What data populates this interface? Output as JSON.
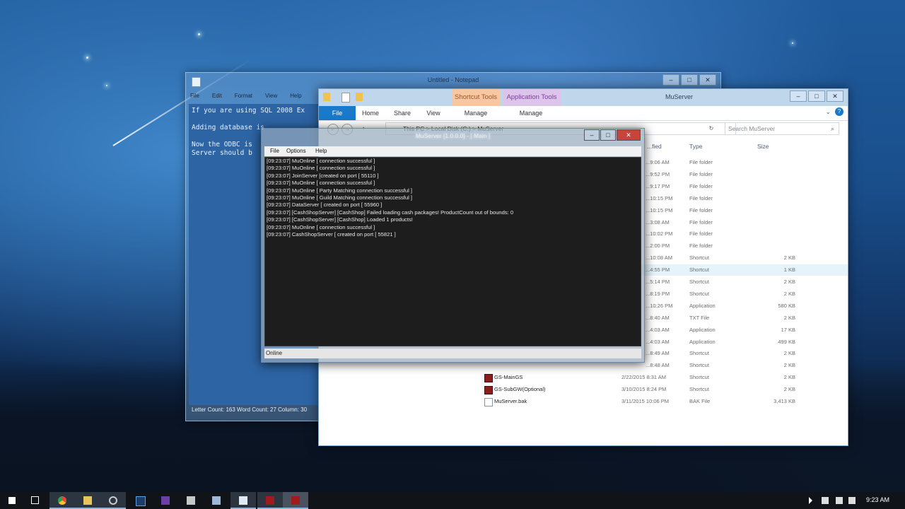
{
  "notepad": {
    "title": "Untitled - Notepad",
    "menu": [
      "File",
      "Edit",
      "Format",
      "View",
      "Help"
    ],
    "lines": [
      "If you are using SQL 2008 Ex",
      "",
      "Adding database is",
      "",
      "Now the ODBC is",
      "Server should b"
    ],
    "status": "Letter Count: 163  Word Count: 27  Column: 30"
  },
  "explorer": {
    "title": "MuServer",
    "context_tabs": [
      "Shortcut Tools",
      "Application Tools"
    ],
    "tabs": [
      "File",
      "Home",
      "Share",
      "View",
      "Manage",
      "Manage"
    ],
    "address": "This PC  >  Local Disk (C:)  >  MuServer",
    "search_placeholder": "Search MuServer",
    "columns": [
      "...fied",
      "Type",
      "Size"
    ],
    "rows": [
      {
        "date": "...9:06 AM",
        "type": "File folder",
        "size": ""
      },
      {
        "date": "...9:52 PM",
        "type": "File folder",
        "size": ""
      },
      {
        "date": "...9:17 PM",
        "type": "File folder",
        "size": ""
      },
      {
        "date": "...10:15 PM",
        "type": "File folder",
        "size": ""
      },
      {
        "date": "...10:15 PM",
        "type": "File folder",
        "size": ""
      },
      {
        "date": "...3:08 AM",
        "type": "File folder",
        "size": ""
      },
      {
        "date": "...10:02 PM",
        "type": "File folder",
        "size": ""
      },
      {
        "date": "...2:00 PM",
        "type": "File folder",
        "size": ""
      },
      {
        "date": "...10:08 AM",
        "type": "Shortcut",
        "size": "2 KB"
      },
      {
        "date": "...4:55 PM",
        "type": "Shortcut",
        "size": "1 KB"
      },
      {
        "date": "...5:14 PM",
        "type": "Shortcut",
        "size": "2 KB"
      },
      {
        "date": "...8:19 PM",
        "type": "Shortcut",
        "size": "2 KB"
      },
      {
        "date": "...10:26 PM",
        "type": "Application",
        "size": "580 KB"
      },
      {
        "date": "...8:40 AM",
        "type": "TXT File",
        "size": "2 KB"
      },
      {
        "date": "...4:03 AM",
        "type": "Application",
        "size": "17 KB"
      },
      {
        "date": "...4:03 AM",
        "type": "Application",
        "size": "499 KB"
      },
      {
        "date": "...8:49 AM",
        "type": "Shortcut",
        "size": "2 KB"
      },
      {
        "date": "...8:48 AM",
        "type": "Shortcut",
        "size": "2 KB"
      },
      {
        "name": "GS-MainGS",
        "date": "2/22/2015 8:31 AM",
        "type": "Shortcut",
        "size": "2 KB"
      },
      {
        "name": "GS-SubGW(Optional)",
        "date": "3/10/2015 8:24 PM",
        "type": "Shortcut",
        "size": "2 KB"
      },
      {
        "name": "MuServer.bak",
        "date": "3/11/2015 10:06 PM",
        "type": "BAK File",
        "size": "3,413 KB"
      }
    ]
  },
  "muserver": {
    "title": "MuServer [1.0.0.0] - [ Main ]",
    "menu": [
      "File",
      "Options",
      "Help"
    ],
    "log": [
      "[09:23:07] MuOnline [ connection successful ]",
      "[09:23:07] MuOnline [ connection successful ]",
      "[09:23:07] JoinServer [created on port [ 55110 ]",
      "[09:23:07] MuOnline [ connection successful ]",
      "[09:23:07] MuOnline [ Party Matching connection successful ]",
      "[09:23:07] MuOnline [ Guild Matching connection successful ]",
      "[09:23:07] DataServer [ created on port [ 55960 ]",
      "[09:23:07] [CashShopServer] [CashShop] Failed loading cash packages! ProductCount out of bounds: 0",
      "[09:23:07] [CashShopServer] [CashShop] Loaded 1 products!",
      "[09:23:07] MuOnline [ connection successful ]",
      "[09:23:07] CashShopServer [ created on port [ 55821 ]"
    ],
    "status": "Online"
  },
  "taskbar": {
    "time": "9:23 AM",
    "items": [
      "start",
      "task-view",
      "chrome",
      "file-explorer",
      "app-1",
      "photoshop",
      "visual-studio",
      "app-2",
      "app-3",
      "notepad",
      "muserver-1",
      "muserver-2"
    ]
  }
}
